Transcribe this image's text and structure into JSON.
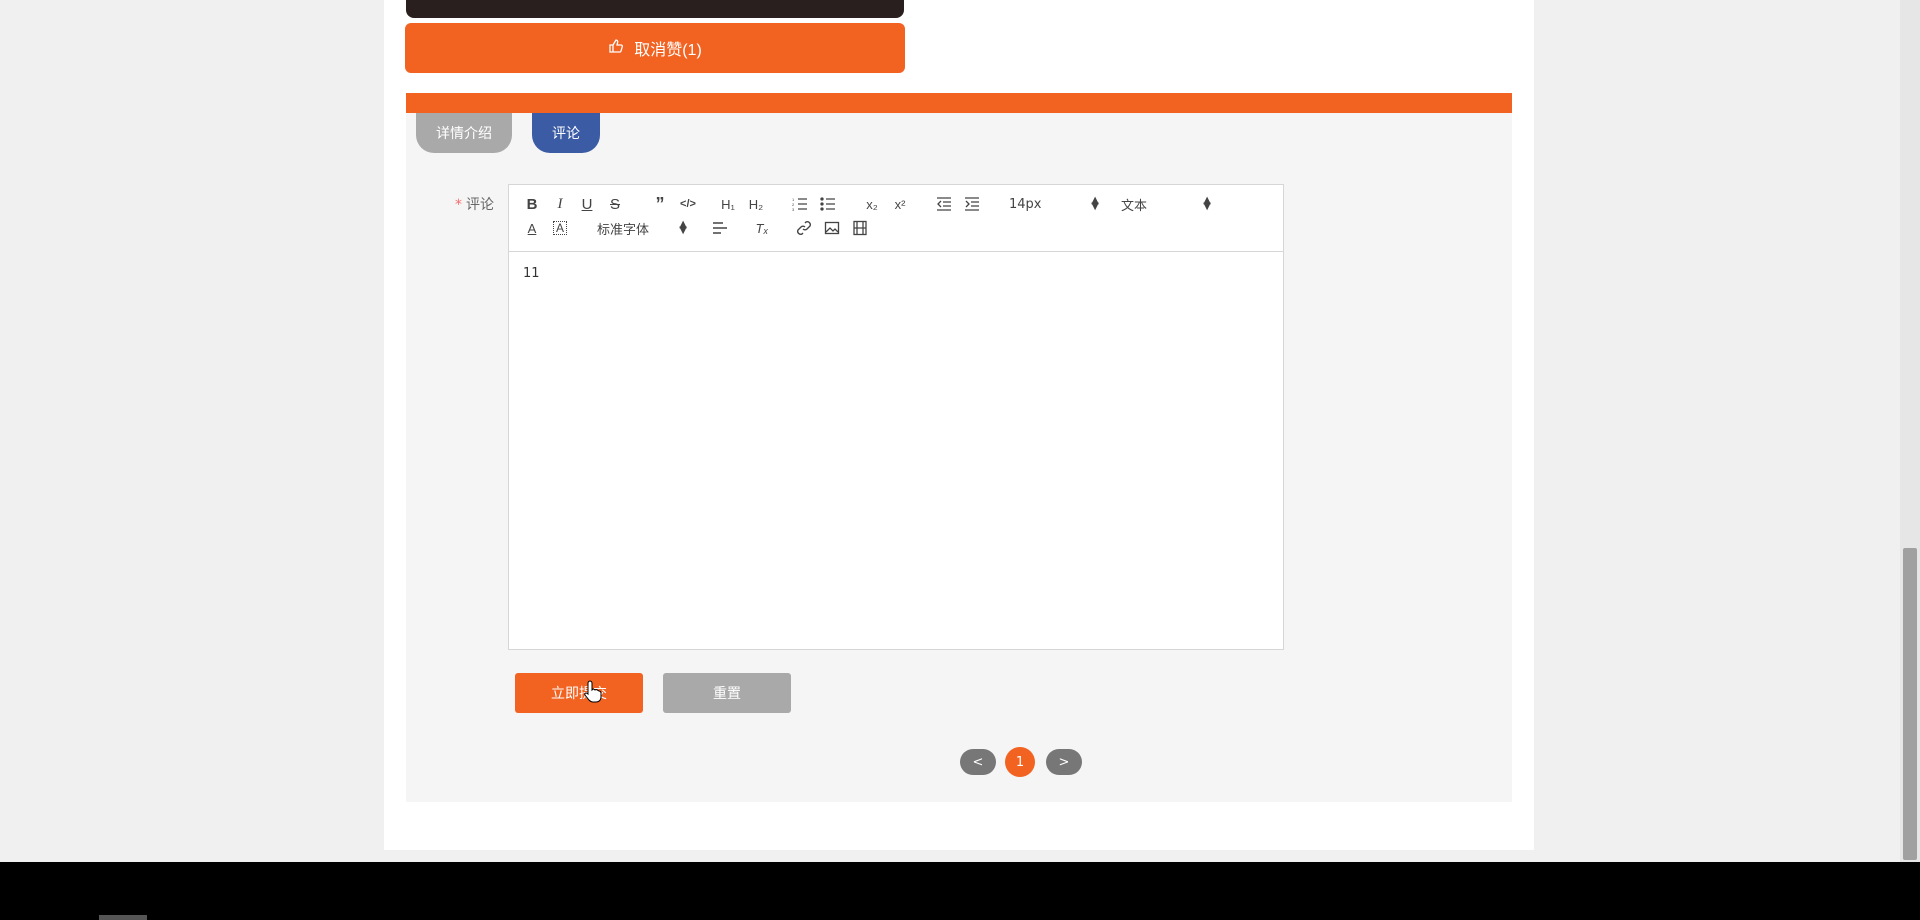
{
  "like_button": {
    "label": "取消赞(1)"
  },
  "tabs": [
    {
      "label": "详情介绍"
    },
    {
      "label": "评论"
    }
  ],
  "comment_field": {
    "required_mark": "*",
    "label": "评论",
    "value": "11"
  },
  "toolbar": {
    "buttons": [
      "bold",
      "italic",
      "underline",
      "strike",
      "blockquote",
      "code-block",
      "h1",
      "h2",
      "ordered-list",
      "bullet-list",
      "subscript",
      "superscript",
      "outdent",
      "indent",
      "font-color",
      "background",
      "align",
      "clean",
      "link",
      "image",
      "video"
    ],
    "size_select": "14px",
    "header_select": "文本",
    "font_select": "标准字体"
  },
  "actions": {
    "submit": "立即提交",
    "reset": "重置"
  },
  "pagination": {
    "prev": "<",
    "current": "1",
    "next": ">"
  },
  "colors": {
    "accent": "#f26321",
    "tab_active": "#3b5ba5",
    "tab_inactive": "#a9a9a9"
  }
}
